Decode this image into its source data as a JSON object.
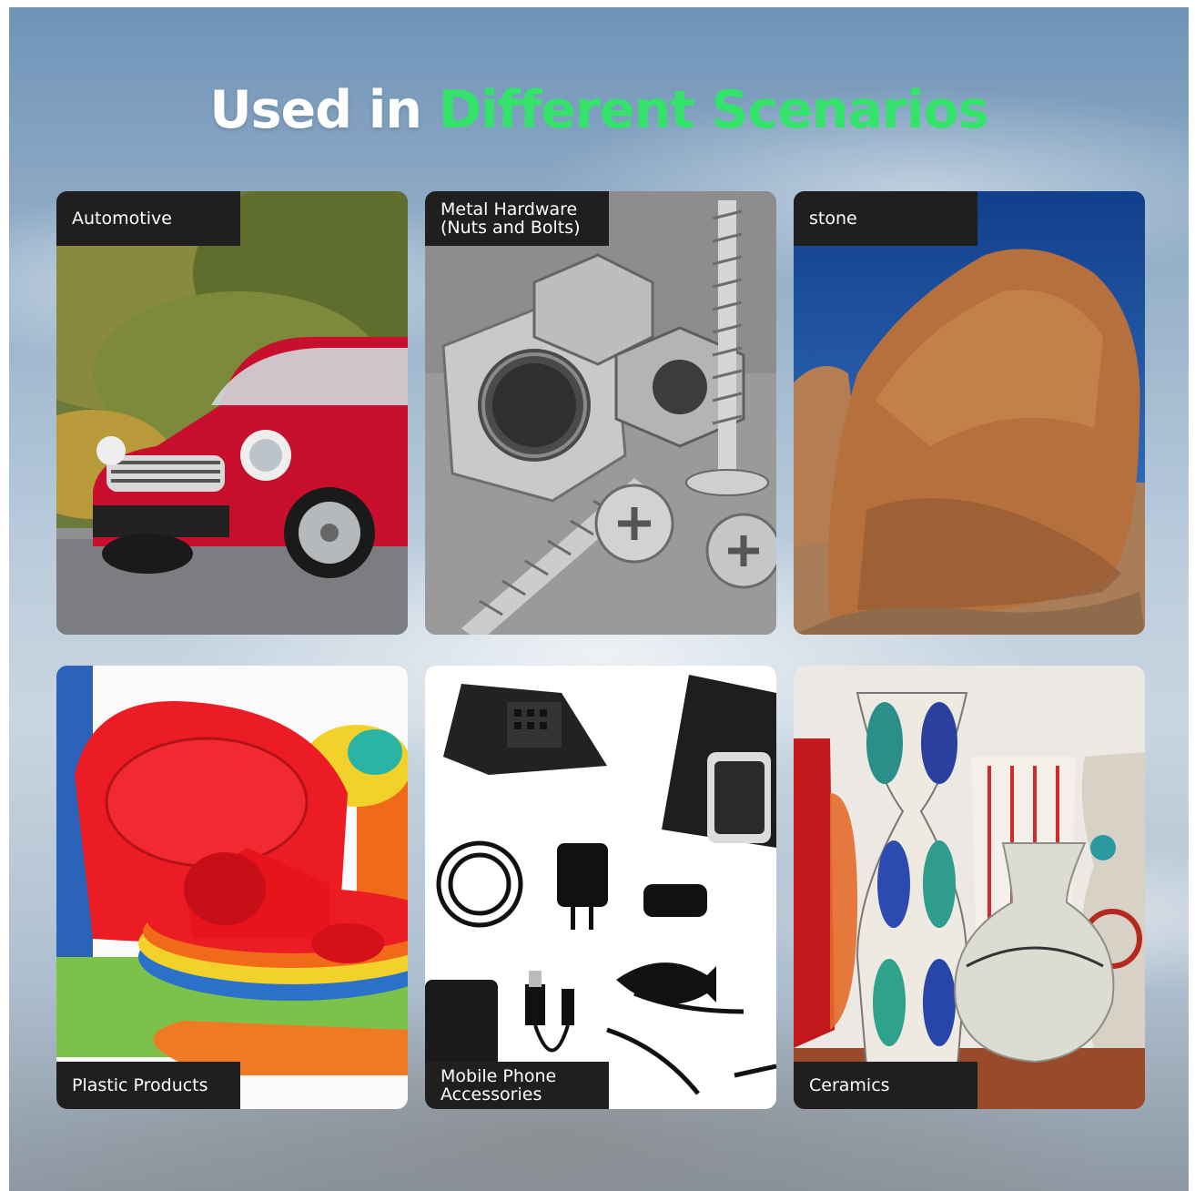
{
  "heading": {
    "part1": "Used in",
    "part2": "Different Scenarios"
  },
  "colors": {
    "accent_green": "#33e36a",
    "label_bg": "#1f1f1f"
  },
  "scenarios": [
    {
      "label": "Automotive",
      "image": "red-car-image"
    },
    {
      "label": "Metal Hardware\n(Nuts and Bolts)",
      "image": "nuts-and-bolts-image"
    },
    {
      "label": "stone",
      "image": "boulder-rock-image"
    },
    {
      "label": "Plastic Products",
      "image": "plastic-tableware-image"
    },
    {
      "label": "Mobile Phone\nAccessories",
      "image": "phone-accessories-image"
    },
    {
      "label": "Ceramics",
      "image": "ceramic-vases-image"
    }
  ]
}
